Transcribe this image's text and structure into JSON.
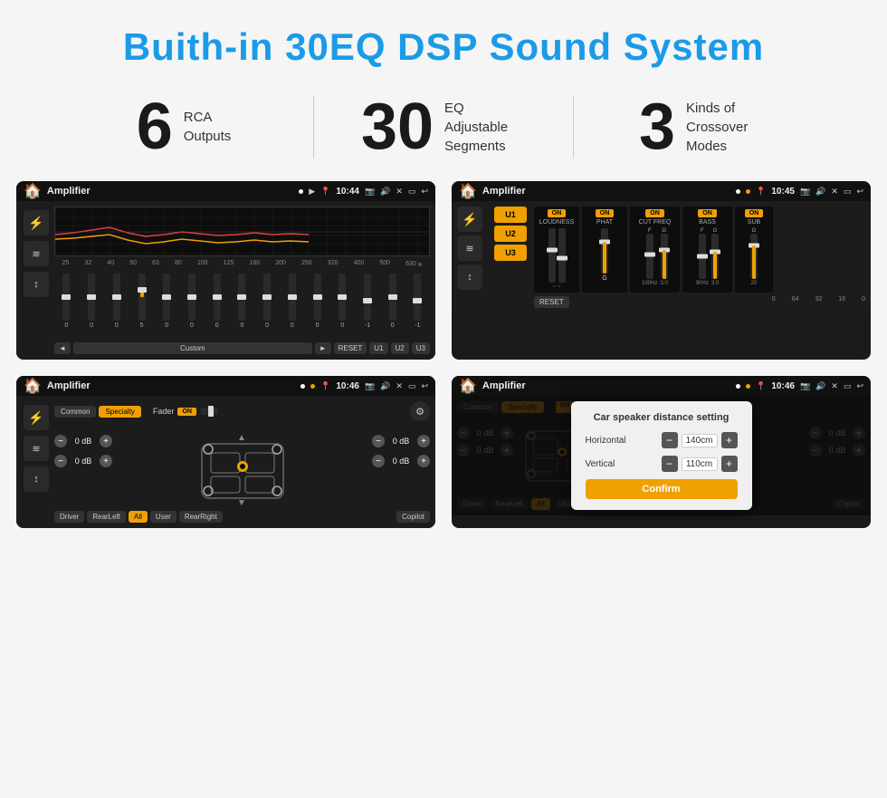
{
  "header": {
    "title": "Buith-in 30EQ DSP Sound System"
  },
  "stats": [
    {
      "number": "6",
      "label_line1": "RCA",
      "label_line2": "Outputs"
    },
    {
      "number": "30",
      "label_line1": "EQ Adjustable",
      "label_line2": "Segments"
    },
    {
      "number": "3",
      "label_line1": "Kinds of",
      "label_line2": "Crossover Modes"
    }
  ],
  "screens": [
    {
      "id": "eq-screen",
      "status_bar": {
        "app": "Amplifier",
        "time": "10:44"
      },
      "eq_labels": [
        "25",
        "32",
        "40",
        "50",
        "63",
        "80",
        "100",
        "125",
        "160",
        "200",
        "250",
        "320",
        "400",
        "500",
        "630"
      ],
      "eq_values": [
        "0",
        "0",
        "0",
        "5",
        "0",
        "0",
        "0",
        "0",
        "0",
        "0",
        "0",
        "0",
        "-1",
        "0",
        "-1"
      ],
      "bottom_buttons": [
        "◄",
        "Custom",
        "►",
        "RESET",
        "U1",
        "U2",
        "U3"
      ]
    },
    {
      "id": "crossover-screen",
      "status_bar": {
        "app": "Amplifier",
        "time": "10:45"
      },
      "presets": [
        "U1",
        "U2",
        "U3"
      ],
      "controls": [
        {
          "on": true,
          "label": "LOUDNESS"
        },
        {
          "on": true,
          "label": "PHAT"
        },
        {
          "on": true,
          "label": "CUT FREQ"
        },
        {
          "on": true,
          "label": "BASS"
        },
        {
          "on": true,
          "label": "SUB"
        }
      ],
      "bottom_buttons": [
        "RESET"
      ]
    },
    {
      "id": "fader-screen",
      "status_bar": {
        "app": "Amplifier",
        "time": "10:46"
      },
      "tabs": [
        "Common",
        "Specialty"
      ],
      "fader_label": "Fader",
      "fader_on": "ON",
      "db_controls": [
        {
          "value": "0 dB"
        },
        {
          "value": "0 dB"
        },
        {
          "value": "0 dB"
        },
        {
          "value": "0 dB"
        }
      ],
      "bottom_buttons": [
        "Driver",
        "RearLeft",
        "All",
        "User",
        "RearRight",
        "Copilot"
      ]
    },
    {
      "id": "dialog-screen",
      "status_bar": {
        "app": "Amplifier",
        "time": "10:46"
      },
      "tabs": [
        "Common",
        "Specialty"
      ],
      "dialog": {
        "title": "Car speaker distance setting",
        "horizontal_label": "Horizontal",
        "horizontal_value": "140cm",
        "vertical_label": "Vertical",
        "vertical_value": "110cm",
        "confirm_label": "Confirm"
      },
      "bottom_buttons": [
        "Driver",
        "RearLeft",
        "All",
        "User",
        "RearRight",
        "Copilot"
      ]
    }
  ]
}
